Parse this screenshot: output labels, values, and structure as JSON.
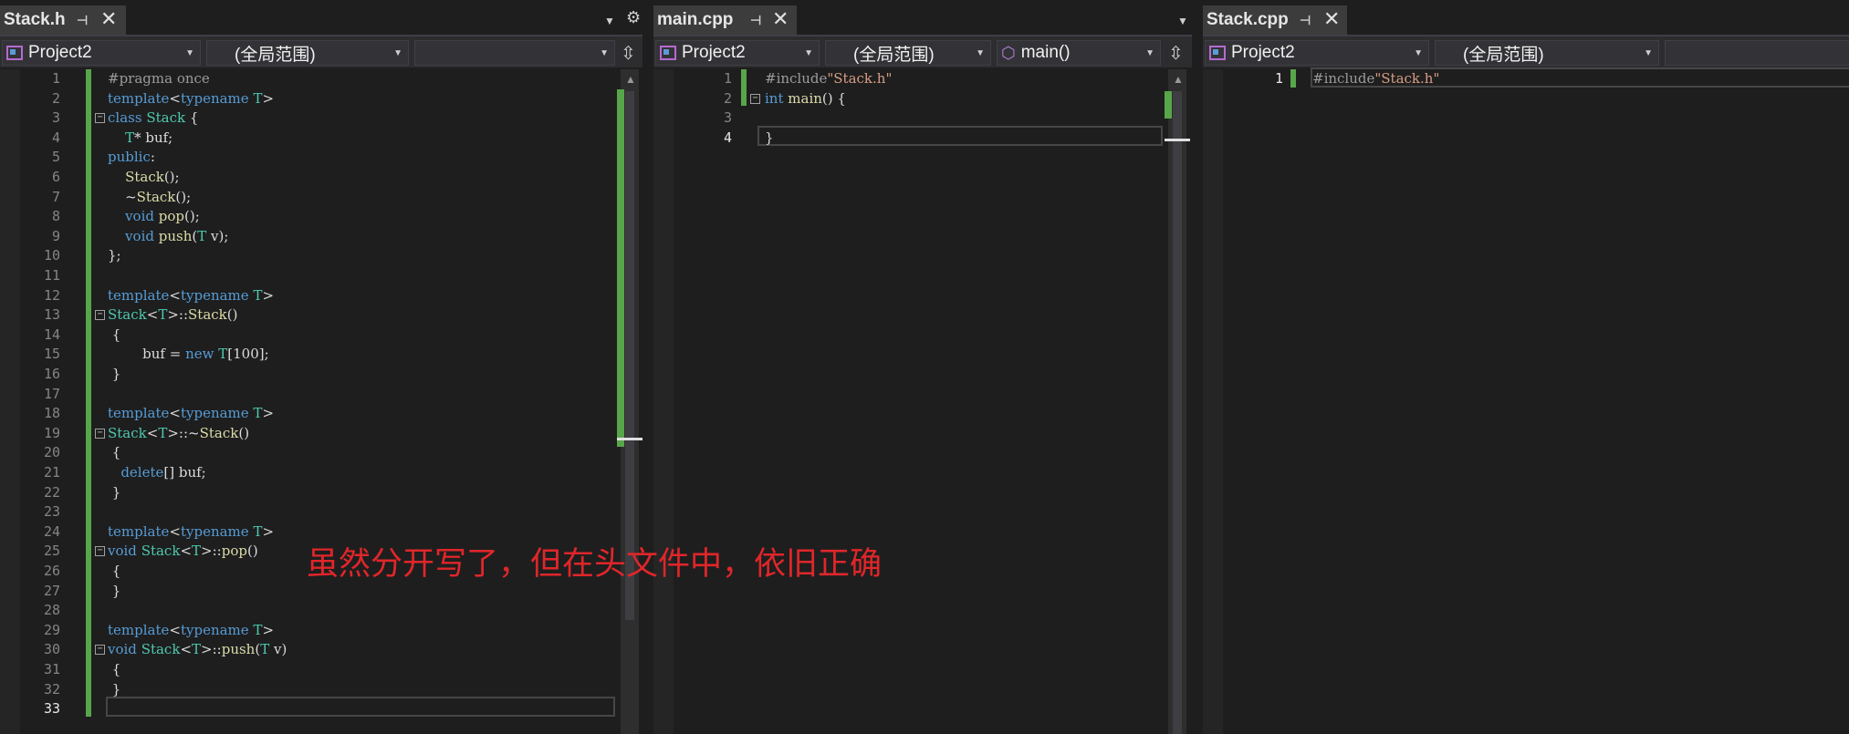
{
  "panes": [
    {
      "tab": "Stack.h",
      "project": "Project2",
      "scope": "(全局范围)",
      "member": "",
      "lines": [
        {
          "n": "1",
          "html": "<span class='pre'>#pragma once</span>"
        },
        {
          "n": "2",
          "html": "<span class='kw'>template</span>&lt;<span class='kw'>typename</span> <span class='ty'>T</span>&gt;"
        },
        {
          "n": "3",
          "html": "<span class='kw'>class</span> <span class='ty'>Stack</span> {"
        },
        {
          "n": "4",
          "html": "    <span class='ty'>T</span>* buf;"
        },
        {
          "n": "5",
          "html": "<span class='kw'>public</span>:"
        },
        {
          "n": "6",
          "html": "    <span class='fn'>Stack</span>();"
        },
        {
          "n": "7",
          "html": "    ~<span class='fn'>Stack</span>();"
        },
        {
          "n": "8",
          "html": "    <span class='kw'>void</span> <span class='fn'>pop</span>();"
        },
        {
          "n": "9",
          "html": "    <span class='kw'>void</span> <span class='fn'>push</span>(<span class='ty'>T</span> v);"
        },
        {
          "n": "10",
          "html": "};"
        },
        {
          "n": "11",
          "html": ""
        },
        {
          "n": "12",
          "html": "<span class='kw'>template</span>&lt;<span class='kw'>typename</span> <span class='ty'>T</span>&gt;"
        },
        {
          "n": "13",
          "html": "<span class='ty'>Stack</span>&lt;<span class='ty'>T</span>&gt;::<span class='fn'>Stack</span>()"
        },
        {
          "n": "14",
          "html": " {"
        },
        {
          "n": "15",
          "html": "        buf = <span class='kw'>new</span> <span class='ty'>T</span>[100];"
        },
        {
          "n": "16",
          "html": " }"
        },
        {
          "n": "17",
          "html": ""
        },
        {
          "n": "18",
          "html": "<span class='kw'>template</span>&lt;<span class='kw'>typename</span> <span class='ty'>T</span>&gt;"
        },
        {
          "n": "19",
          "html": "<span class='ty'>Stack</span>&lt;<span class='ty'>T</span>&gt;::~<span class='fn'>Stack</span>()"
        },
        {
          "n": "20",
          "html": " {"
        },
        {
          "n": "21",
          "html": "   <span class='kw'>delete</span>[] buf;"
        },
        {
          "n": "22",
          "html": " }"
        },
        {
          "n": "23",
          "html": ""
        },
        {
          "n": "24",
          "html": "<span class='kw'>template</span>&lt;<span class='kw'>typename</span> <span class='ty'>T</span>&gt;"
        },
        {
          "n": "25",
          "html": "<span class='kw'>void</span> <span class='ty'>Stack</span>&lt;<span class='ty'>T</span>&gt;::<span class='fn'>pop</span>()"
        },
        {
          "n": "26",
          "html": " {"
        },
        {
          "n": "27",
          "html": " }"
        },
        {
          "n": "28",
          "html": ""
        },
        {
          "n": "29",
          "html": "<span class='kw'>template</span>&lt;<span class='kw'>typename</span> <span class='ty'>T</span>&gt;"
        },
        {
          "n": "30",
          "html": "<span class='kw'>void</span> <span class='ty'>Stack</span>&lt;<span class='ty'>T</span>&gt;::<span class='fn'>push</span>(<span class='ty'>T</span> v)"
        },
        {
          "n": "31",
          "html": " {"
        },
        {
          "n": "32",
          "html": " }"
        },
        {
          "n": "33",
          "html": ""
        }
      ],
      "current_line": "33"
    },
    {
      "tab": "main.cpp",
      "project": "Project2",
      "scope": "(全局范围)",
      "member": "main()",
      "lines": [
        {
          "n": "1",
          "html": "<span class='pre'>#include</span><span class='str'>\"Stack.h\"</span>"
        },
        {
          "n": "2",
          "html": "<span class='kw'>int</span> <span class='fn'>main</span>() {"
        },
        {
          "n": "3",
          "html": ""
        },
        {
          "n": "4",
          "html": "}"
        }
      ],
      "current_line": "4"
    },
    {
      "tab": "Stack.cpp",
      "project": "Project2",
      "scope": "(全局范围)",
      "member": "",
      "lines": [
        {
          "n": "1",
          "html": "<span class='pre'>#include</span><span class='str'>\"Stack.h\"</span>"
        }
      ],
      "current_line": "1"
    }
  ],
  "icons": {
    "pin": "pin-icon",
    "close": "close-icon",
    "dropdown": "dropdown-arrow-icon",
    "settings": "gear-icon",
    "split": "split-window-icon",
    "project": "project-icon",
    "member": "cube-icon"
  },
  "annotation_text": "虽然分开写了，但在头文件中，依旧正确",
  "colors": {
    "background": "#1e1e1e",
    "keyword": "#569cd6",
    "type": "#4ec9b0",
    "string": "#d69d85",
    "change_bar": "#57a64a",
    "annotation": "#e0262a"
  }
}
